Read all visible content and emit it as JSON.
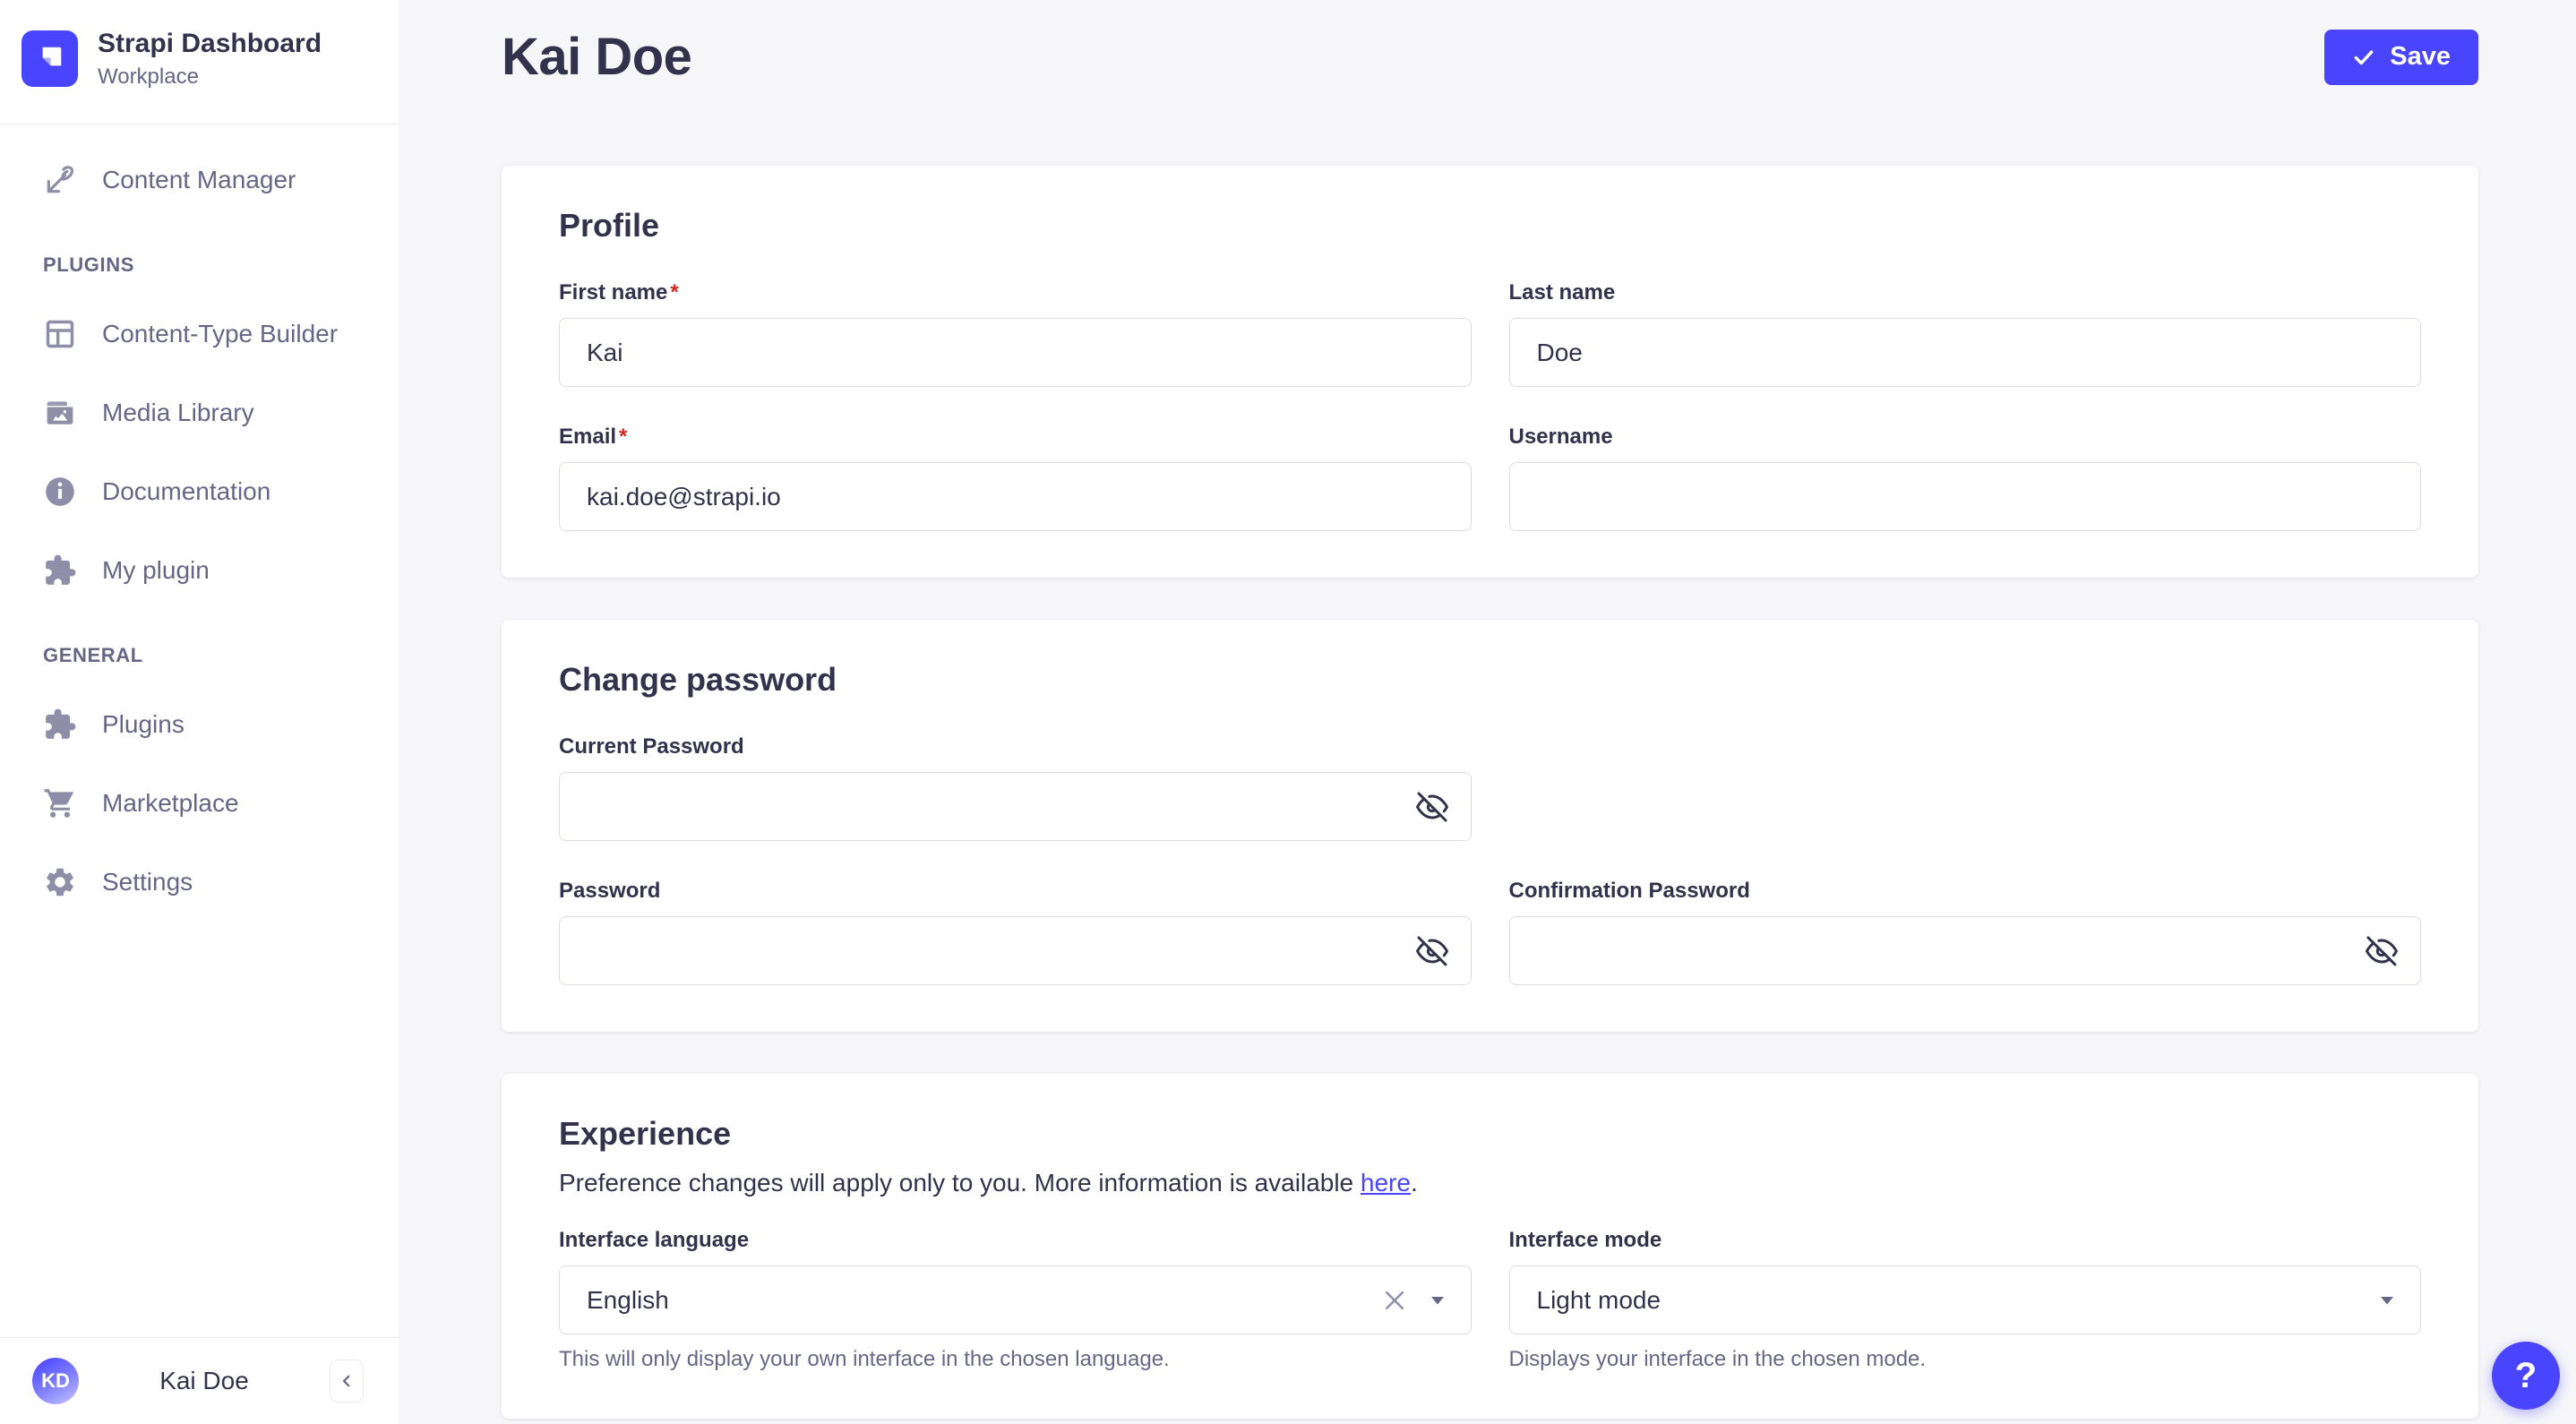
{
  "colors": {
    "accent": "#4945FF",
    "background": "#F6F6F9",
    "surface": "#FFFFFF",
    "text": "#32324D",
    "muted": "#666687",
    "icon": "#8E8EA9",
    "input_border": "#DCDCE4",
    "divider": "#EAEAEF",
    "required": "#D02B20"
  },
  "brand": {
    "title": "Strapi Dashboard",
    "subtitle": "Workplace"
  },
  "sidebar": {
    "main_item": {
      "label": "Content Manager",
      "icon": "edit-pen-icon"
    },
    "sections": [
      {
        "label": "PLUGINS",
        "items": [
          {
            "label": "Content-Type Builder",
            "icon": "layout-icon"
          },
          {
            "label": "Media Library",
            "icon": "image-icon"
          },
          {
            "label": "Documentation",
            "icon": "info-circle-icon"
          },
          {
            "label": "My plugin",
            "icon": "puzzle-icon"
          }
        ]
      },
      {
        "label": "GENERAL",
        "items": [
          {
            "label": "Plugins",
            "icon": "puzzle-icon"
          },
          {
            "label": "Marketplace",
            "icon": "cart-icon"
          },
          {
            "label": "Settings",
            "icon": "gear-icon"
          }
        ]
      }
    ],
    "user": {
      "initials": "KD",
      "name": "Kai Doe"
    }
  },
  "header": {
    "title": "Kai Doe",
    "save": {
      "label": "Save",
      "icon": "check-icon"
    }
  },
  "profile_card": {
    "title": "Profile",
    "first_name": {
      "label": "First name",
      "required": "*",
      "value": "Kai"
    },
    "last_name": {
      "label": "Last name",
      "value": "Doe"
    },
    "email": {
      "label": "Email",
      "required": "*",
      "value": "kai.doe@strapi.io"
    },
    "username": {
      "label": "Username",
      "value": ""
    }
  },
  "password_card": {
    "title": "Change password",
    "current": {
      "label": "Current Password",
      "value": ""
    },
    "new": {
      "label": "Password",
      "value": ""
    },
    "confirm": {
      "label": "Confirmation Password",
      "value": ""
    }
  },
  "experience_card": {
    "title": "Experience",
    "subtitle_before": "Preference changes will apply only to you. More information is available ",
    "subtitle_link": "here",
    "subtitle_after": ".",
    "language": {
      "label": "Interface language",
      "value": "English",
      "hint": "This will only display your own interface in the chosen language."
    },
    "mode": {
      "label": "Interface mode",
      "value": "Light mode",
      "hint": "Displays your interface in the chosen mode."
    }
  },
  "help": {
    "label": "?"
  }
}
